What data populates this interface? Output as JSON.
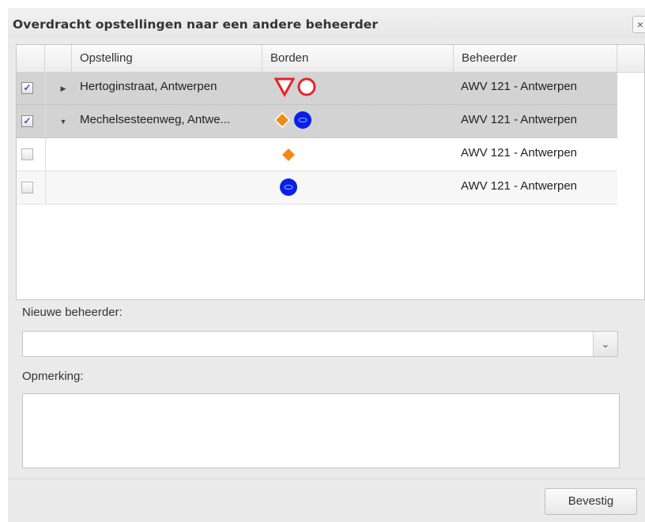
{
  "dialog": {
    "title": "Overdracht opstellingen naar een andere beheerder",
    "close_label": "×"
  },
  "grid": {
    "columns": [
      "",
      "",
      "Opstelling",
      "Borden",
      "Beheerder"
    ],
    "rows": [
      {
        "checked": true,
        "expander": "▶",
        "opstelling": "Hertoginstraat, Antwerpen",
        "borden": [
          "triangle-red-sign-icon",
          "circle-red-sign-icon"
        ],
        "beheerder": "AWV 121 - Antwerpen"
      },
      {
        "checked": true,
        "expander": "▼",
        "opstelling": "Mechelsesteenweg, Antwe...",
        "borden": [
          "diamond-orange-sign-icon",
          "circle-blue-sign-icon"
        ],
        "beheerder": "AWV 121 - Antwerpen"
      },
      {
        "checked": false,
        "expander": "",
        "opstelling": "",
        "borden": [
          "diamond-orange-sign-icon"
        ],
        "beheerder": "AWV 121 - Antwerpen"
      },
      {
        "checked": false,
        "expander": "",
        "opstelling": "",
        "borden": [
          "circle-blue-sign-icon"
        ],
        "beheerder": "AWV 121 - Antwerpen"
      }
    ]
  },
  "form": {
    "new_manager_label": "Nieuwe beheerder:",
    "new_manager_value": "",
    "dropdown_arrow": "⌄",
    "remark_label": "Opmerking:",
    "remark_value": ""
  },
  "footer": {
    "confirm_label": "Bevestig"
  },
  "colors": {
    "selected_row": "#d3d3d3",
    "sign_red": "#e8222a",
    "sign_orange": "#f08a17",
    "sign_blue": "#0a1fe8",
    "checkmark": "#2c55b5"
  }
}
